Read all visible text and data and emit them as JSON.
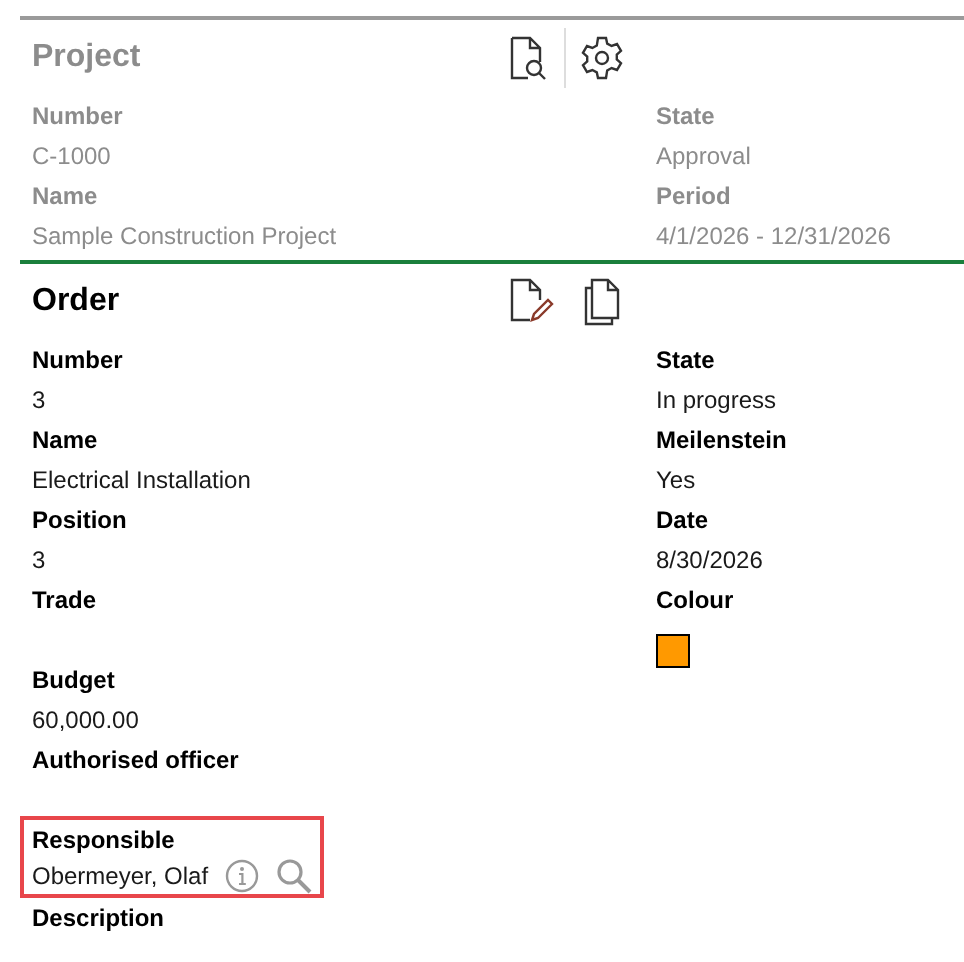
{
  "project": {
    "title": "Project",
    "disabled": true,
    "left": [
      {
        "label": "Number",
        "value": "C-1000"
      },
      {
        "label": "Name",
        "value": "Sample Construction Project"
      }
    ],
    "right": [
      {
        "label": "State",
        "value": "Approval"
      },
      {
        "label": "Period",
        "value": "4/1/2026 - 12/31/2026"
      }
    ]
  },
  "order": {
    "title": "Order",
    "left": [
      {
        "label": "Number",
        "value": "3",
        "highlighted": false,
        "lookup": false
      },
      {
        "label": "Name",
        "value": "Electrical Installation",
        "highlighted": false,
        "lookup": false
      },
      {
        "label": "Position",
        "value": "3",
        "highlighted": false,
        "lookup": false
      },
      {
        "label": "Trade",
        "highlighted": false,
        "lookup": false
      },
      {
        "label": "Budget",
        "value": "60,000.00",
        "highlighted": false,
        "lookup": false
      },
      {
        "label": "Authorised officer",
        "highlighted": false,
        "lookup": false
      },
      {
        "label": "Responsible",
        "value": "Obermeyer, Olaf",
        "highlighted": true,
        "lookup": true
      },
      {
        "label": "Description",
        "highlighted": false,
        "lookup": false
      }
    ],
    "right": [
      {
        "label": "State",
        "value": "In progress",
        "highlighted": false,
        "lookup": false
      },
      {
        "label": "Meilenstein",
        "value": "Yes",
        "highlighted": false,
        "lookup": false
      },
      {
        "label": "Date",
        "value": "8/30/2026",
        "highlighted": false,
        "lookup": false
      },
      {
        "label": "Colour",
        "color": "#ff9900",
        "highlighted": false,
        "lookup": false
      }
    ]
  }
}
